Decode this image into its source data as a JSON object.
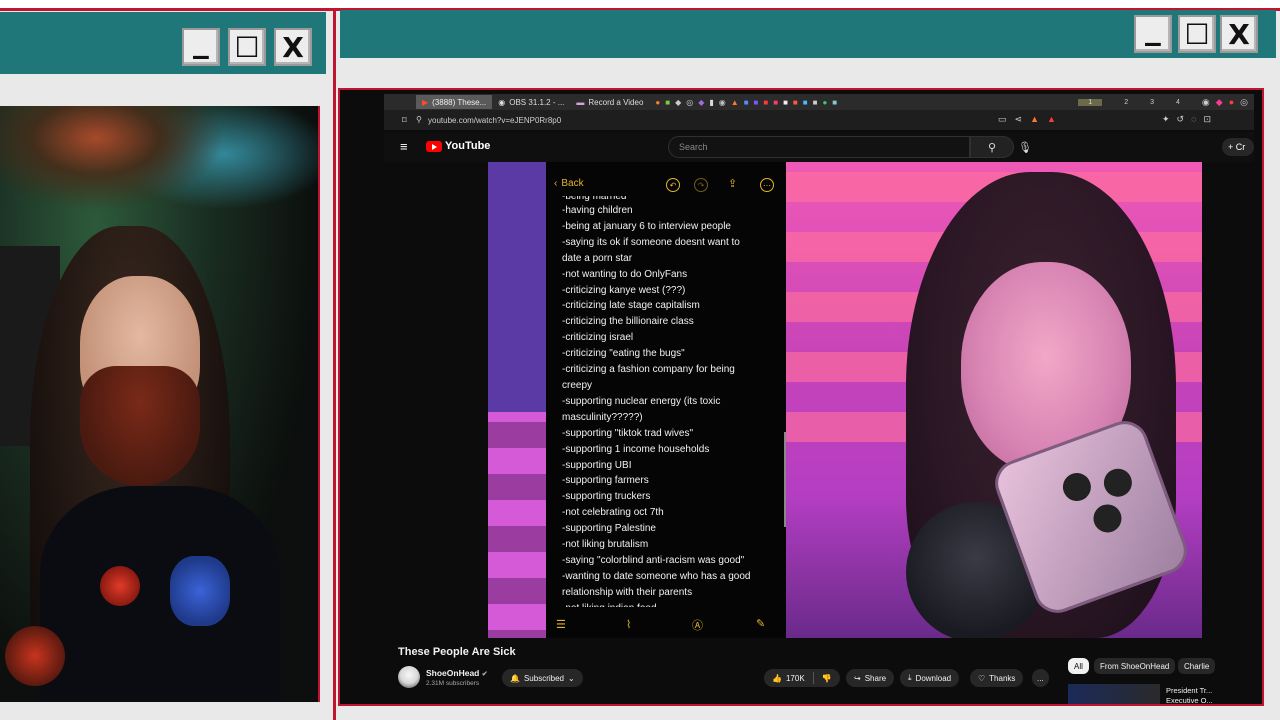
{
  "left_window": {
    "controls": {
      "minimize": "▁",
      "maximize": "☐",
      "close": "X"
    }
  },
  "right_window": {
    "controls": {
      "minimize": "▁",
      "maximize": "☐",
      "close": "X"
    }
  },
  "browser": {
    "tabs": [
      {
        "label": "(3888) These...",
        "active": true
      },
      {
        "label": "OBS 31.1.2 - ...",
        "active": false
      },
      {
        "label": "Record a Video",
        "active": false
      }
    ],
    "workspaces": [
      "1",
      "2",
      "3",
      "4"
    ],
    "url": "youtube.com/watch?v=eJENP0Rr8p0"
  },
  "youtube": {
    "logo_text": "YouTube",
    "search_placeholder": "Search",
    "create_label": "+ Cr"
  },
  "phone_note": {
    "back_label": "Back",
    "lines": [
      "-being married",
      "-having children",
      "-being at january 6 to interview people",
      "-saying its ok if someone doesnt want to",
      "date a porn star",
      "-not wanting to do OnlyFans",
      "-criticizing kanye west (???)",
      "-criticizing late stage capitalism",
      "-criticizing the billionaire class",
      "-criticizing israel",
      "-criticizing \"eating the bugs\"",
      "-criticizing a fashion company for being",
      "creepy",
      "-supporting nuclear energy (its toxic",
      "masculinity?????)",
      "-supporting \"tiktok trad wives\"",
      "-supporting 1 income households",
      "-supporting UBI",
      "-supporting farmers",
      "-supporting truckers",
      "-not celebrating oct 7th",
      "-supporting Palestine",
      "-not liking brutalism",
      "-saying \"colorblind anti-racism was good\"",
      "-wanting to date someone who has a good",
      "relationship with their parents",
      "-not liking indian food"
    ]
  },
  "video_info": {
    "title": "These People Are Sick",
    "channel": "ShoeOnHead",
    "subscribers": "2.31M subscribers",
    "subscribed_label": "Subscribed",
    "likes": "170K",
    "share_label": "Share",
    "download_label": "Download",
    "thanks_label": "Thanks",
    "more_label": "..."
  },
  "sidebar_chips": [
    "All",
    "From ShoeOnHead",
    "Charlie"
  ],
  "next_video": {
    "title": "President Tr... Executive O..."
  },
  "colors": {
    "titlebar": "#1f7779",
    "window_border": "#c01530",
    "youtube_red": "#ff0000",
    "notes_accent": "#e3b52d"
  }
}
